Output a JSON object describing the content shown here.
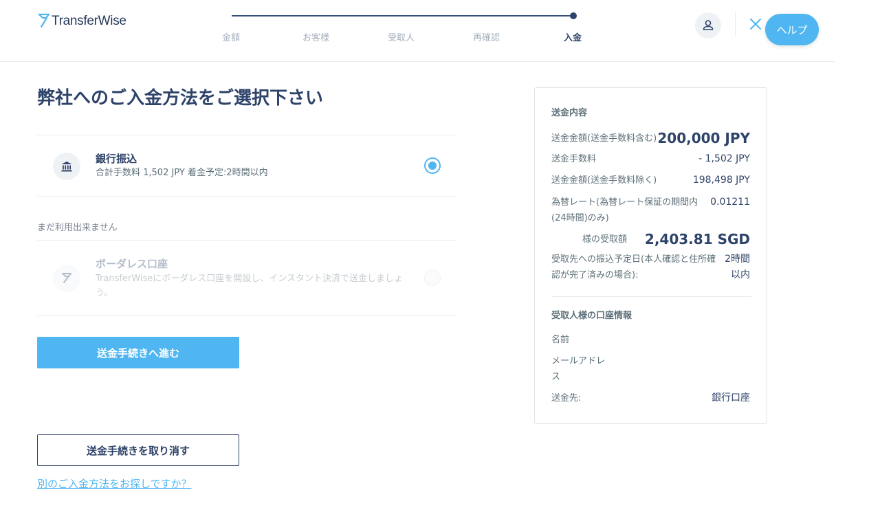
{
  "header": {
    "logo_text": "TransferWise",
    "steps": [
      {
        "label": "金額"
      },
      {
        "label": "お客様"
      },
      {
        "label": "受取人"
      },
      {
        "label": "再確認"
      },
      {
        "label": "入金"
      }
    ],
    "help_label": "ヘルプ"
  },
  "main": {
    "title": "弊社へのご入金方法をご選択下さい",
    "options": [
      {
        "title": "銀行振込",
        "description": "合計手数料 1,502 JPY 着金予定:2時間以内",
        "selected": true
      },
      {
        "title": "ボーダレス口座",
        "description": "TransferWiseにボーダレス口座を開設し、インスタント決済で送金しましょう。",
        "selected": false
      }
    ],
    "unavailable_label": "まだ利用出来ません",
    "continue_label": "送金手続きへ進む",
    "cancel_label": "送金手続きを取り消す",
    "alt_method_link": "別のご入金方法をお探しですか？"
  },
  "summary": {
    "section_title": "送金内容",
    "rows": [
      {
        "label": "送金金額(送金手数料含む)",
        "value": "200,000 JPY"
      },
      {
        "label": "送金手数料",
        "value": "- 1,502 JPY"
      },
      {
        "label": "送金金額(送金手数料除く)",
        "value": "198,498 JPY"
      },
      {
        "label": "為替レート(為替レート保証の期間内(24時間)のみ)",
        "value": "0.01211"
      },
      {
        "label": "様の受取額",
        "value": "2,403.81 SGD"
      },
      {
        "label": "受取先への振込予定日(本人確認と住所確認が完了済みの場合):",
        "value_line1": "2時間",
        "value_line2": "以内"
      }
    ],
    "recipient_title": "受取人様の口座情報",
    "recipient_rows": [
      {
        "label": "名前",
        "value": ""
      },
      {
        "label": "メールアドレス",
        "value": ""
      },
      {
        "label": "送金先:",
        "value": "銀行口座"
      }
    ]
  },
  "colors": {
    "accent": "#4fb6f2",
    "navy": "#2e4369",
    "muted": "#5d7079"
  }
}
